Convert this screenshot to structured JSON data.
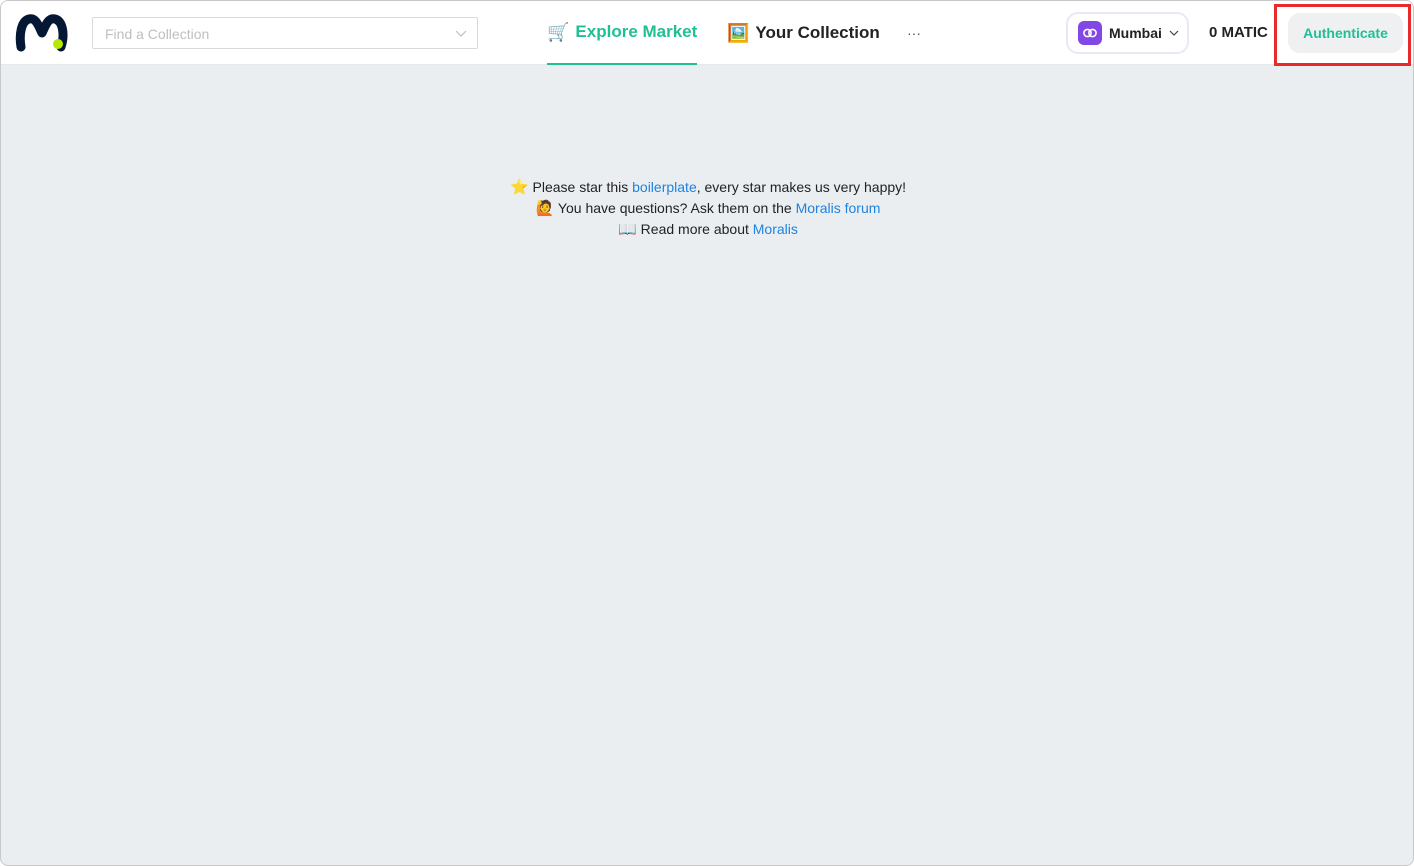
{
  "header": {
    "search": {
      "placeholder": "Find a Collection"
    },
    "nav": [
      {
        "emoji": "🛒",
        "label": "Explore Market"
      },
      {
        "emoji": "🖼️",
        "label": "Your Collection"
      }
    ],
    "more_label": "···",
    "chain": {
      "label": "Mumbai",
      "icon": "polygon-icon"
    },
    "balance": "0 MATIC",
    "auth_label": "Authenticate"
  },
  "info": {
    "line1": {
      "emoji": "⭐️",
      "before": " Please star this ",
      "link": "boilerplate",
      "after": ", every star makes us very happy!"
    },
    "line2": {
      "emoji": "🙋",
      "before": " You have questions? Ask them on the ",
      "link": "Moralis forum"
    },
    "line3": {
      "emoji": "📖",
      "before": " Read more about ",
      "link": "Moralis"
    }
  },
  "colors": {
    "accent": "#21bf96",
    "link": "#1d83e0",
    "highlight": "#e82a2a",
    "polygon": "#8247e5",
    "background": "#ebeef1"
  }
}
